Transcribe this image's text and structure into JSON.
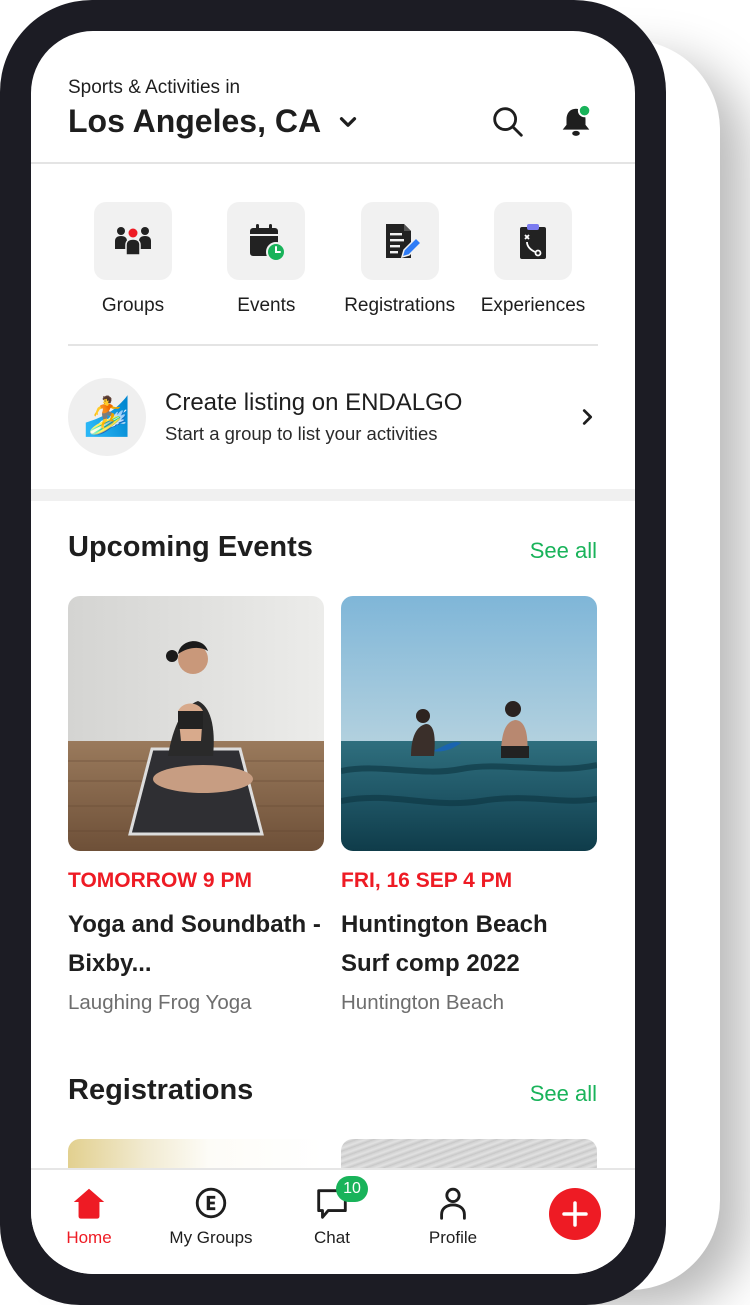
{
  "header": {
    "subtitle": "Sports & Activities in",
    "city": "Los Angeles, CA"
  },
  "categories": [
    {
      "label": "Groups",
      "icon": "groups-icon"
    },
    {
      "label": "Events",
      "icon": "calendar-clock-icon"
    },
    {
      "label": "Registrations",
      "icon": "document-pen-icon"
    },
    {
      "label": "Experiences",
      "icon": "clipboard-play-icon"
    }
  ],
  "promo": {
    "title": "Create listing on ENDALGO",
    "subtitle": "Start a group to list your activities",
    "icon": "surfer-emoji"
  },
  "upcoming": {
    "title": "Upcoming Events",
    "see_all": "See all",
    "events": [
      {
        "date": "TOMORROW 9 PM",
        "title": "Yoga and Soundbath - Bixby...",
        "organizer": "Laughing Frog Yoga",
        "image": "yoga-photo"
      },
      {
        "date": "FRI, 16 SEP 4 PM",
        "title": "Huntington Beach Surf comp 2022",
        "organizer": "Huntington Beach",
        "image": "surf-photo"
      }
    ]
  },
  "registrations": {
    "title": "Registrations",
    "see_all": "See all"
  },
  "tabbar": {
    "items": [
      {
        "label": "Home",
        "active": true
      },
      {
        "label": "My Groups"
      },
      {
        "label": "Chat",
        "badge": "10"
      },
      {
        "label": "Profile"
      }
    ]
  },
  "colors": {
    "accent_red": "#ee1b24",
    "accent_green": "#19b35a"
  }
}
